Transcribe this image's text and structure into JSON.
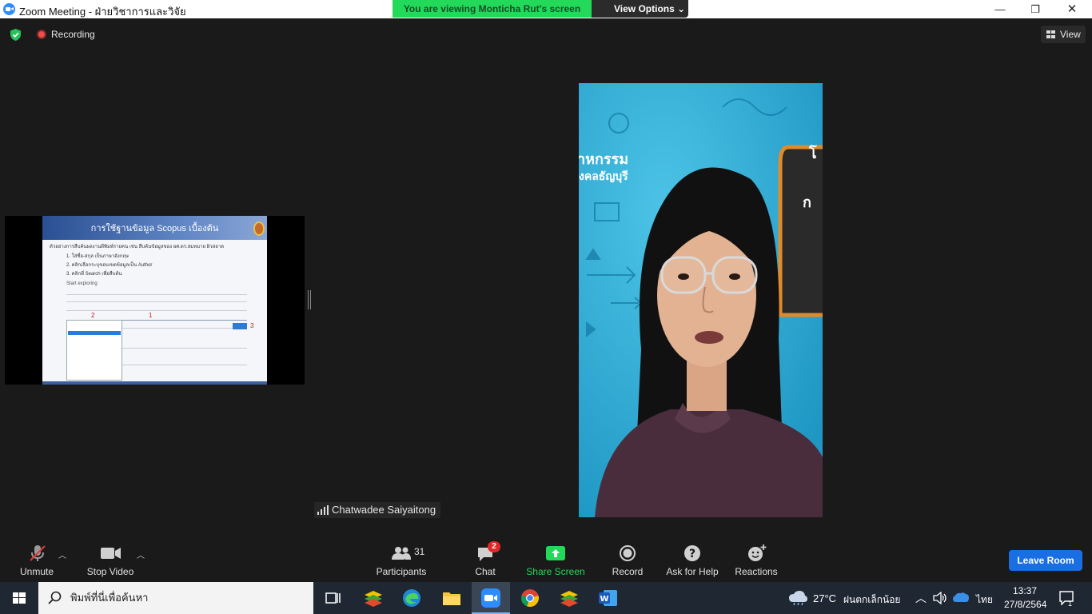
{
  "window": {
    "title": "Zoom Meeting - ฝ่ายวิชาการและวิจัย",
    "minimize_glyph": "—",
    "maximize_glyph": "❐",
    "close_glyph": "✕"
  },
  "share_banner": {
    "text": "You are viewing Monticha Rut's screen",
    "view_options_label": "View Options ⌄"
  },
  "topbar": {
    "recording_label": "Recording",
    "view_label": "View"
  },
  "shared_slide": {
    "title": "การใช้ฐานข้อมูล Scopus เบื้องต้น",
    "bullet": "ตัวอย่างการสืบค้นผลงานตีพิมพ์รายคน เช่น สืบค้นข้อมูลของ ผศ.ดร.สมหมาย ผิวสอาด",
    "steps": [
      "1. ใส่ชื่อ-สกุล เป็นภาษาอังกฤษ",
      "2. คลิกเลือกระบุขอบเขตข้อมูลเป็น Author",
      "3. คลิกที่ Search เพื่อสืบค้น"
    ],
    "start_exploring": "Start exploring",
    "markers": [
      "1",
      "2",
      "3"
    ],
    "search_btn": "Search"
  },
  "video": {
    "participant_name": "Chatwadee Saiyaitong",
    "background_text_1": "าหกรรม",
    "background_text_2": "งคลธัญบุรี"
  },
  "toolbar": {
    "unmute": "Unmute",
    "stop_video": "Stop Video",
    "participants": "Participants",
    "participants_count": "31",
    "chat": "Chat",
    "chat_badge": "2",
    "share_screen": "Share Screen",
    "record": "Record",
    "ask_for_help": "Ask for Help",
    "reactions": "Reactions",
    "leave_room": "Leave Room"
  },
  "taskbar": {
    "search_placeholder": "พิมพ์ที่นี่เพื่อค้นหา",
    "weather_temp": "27°C",
    "weather_desc": "ฝนตกเล็กน้อย",
    "language": "ไทย",
    "time": "13:37",
    "date": "27/8/2564",
    "notification_count": "1"
  },
  "colors": {
    "share_green": "#23d959",
    "leave_blue": "#1a6ee3",
    "record_red": "#f24b4b",
    "share_screen_green": "#23d959"
  }
}
